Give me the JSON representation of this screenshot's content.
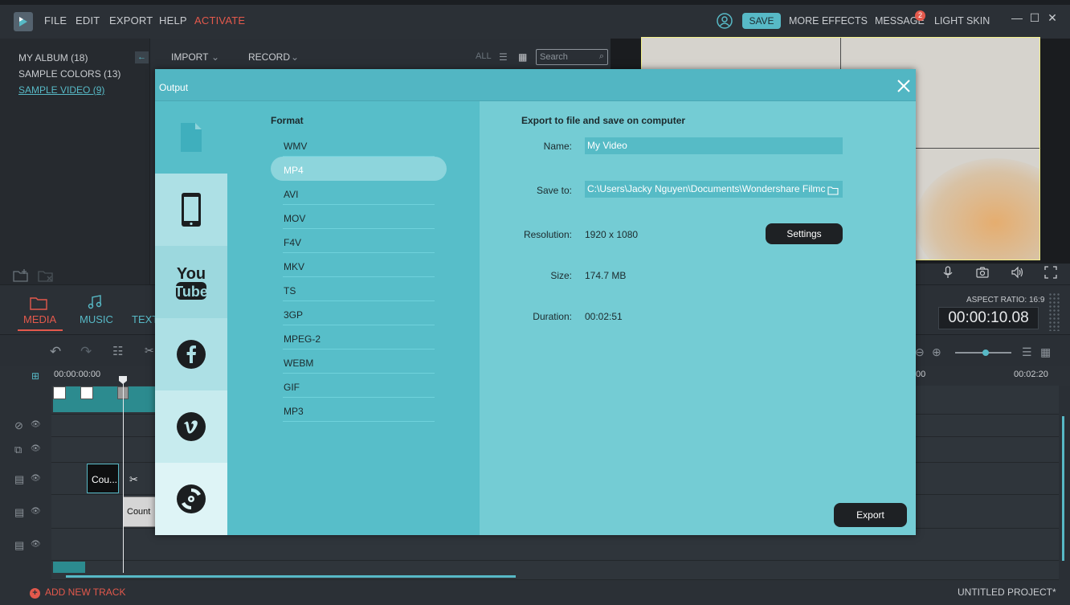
{
  "menu": {
    "items": [
      "FILE",
      "EDIT",
      "EXPORT",
      "HELP"
    ],
    "activate": "ACTIVATE",
    "save": "SAVE",
    "more_effects": "MORE EFFECTS",
    "message": "MESSAGE",
    "message_count": "2",
    "light_skin": "LIGHT SKIN"
  },
  "album": {
    "items": [
      "MY ALBUM (18)",
      "SAMPLE COLORS (13)",
      "SAMPLE VIDEO (9)"
    ]
  },
  "media_toolbar": {
    "import": "IMPORT",
    "record": "RECORD",
    "all": "ALL",
    "search_placeholder": "Search"
  },
  "tabs": {
    "media": "MEDIA",
    "music": "MUSIC",
    "text": "TEXT"
  },
  "preview": {
    "aspect_ratio": "ASPECT RATIO: 16:9",
    "timecode": "00:00:10.08"
  },
  "timeline": {
    "start_time": "00:00:00:00",
    "mid_time": "00",
    "end_time": "00:02:20",
    "title_clip": "Cou...",
    "text_clip": "Count",
    "add_track": "ADD NEW TRACK",
    "project_name": "UNTITLED PROJECT*"
  },
  "dialog": {
    "title": "Output",
    "format_heading": "Format",
    "formats": [
      "WMV",
      "MP4",
      "AVI",
      "MOV",
      "F4V",
      "MKV",
      "TS",
      "3GP",
      "MPEG-2",
      "WEBM",
      "GIF",
      "MP3"
    ],
    "selected_format": "MP4",
    "export_heading": "Export to file and save on computer",
    "name_label": "Name:",
    "name_value": "My Video",
    "save_label": "Save to:",
    "save_value": "C:\\Users\\Jacky Nguyen\\Documents\\Wondershare Filmc",
    "resolution_label": "Resolution:",
    "resolution_value": "1920 x 1080",
    "settings_button": "Settings",
    "size_label": "Size:",
    "size_value": "174.7 MB",
    "duration_label": "Duration:",
    "duration_value": "00:02:51",
    "export_button": "Export",
    "side_tabs": [
      "local-file",
      "device",
      "youtube",
      "facebook",
      "vimeo",
      "dvd"
    ]
  },
  "colors": {
    "accent": "#57b9c6",
    "active": "#e4594c",
    "dialog_bg": "#57bec9"
  }
}
